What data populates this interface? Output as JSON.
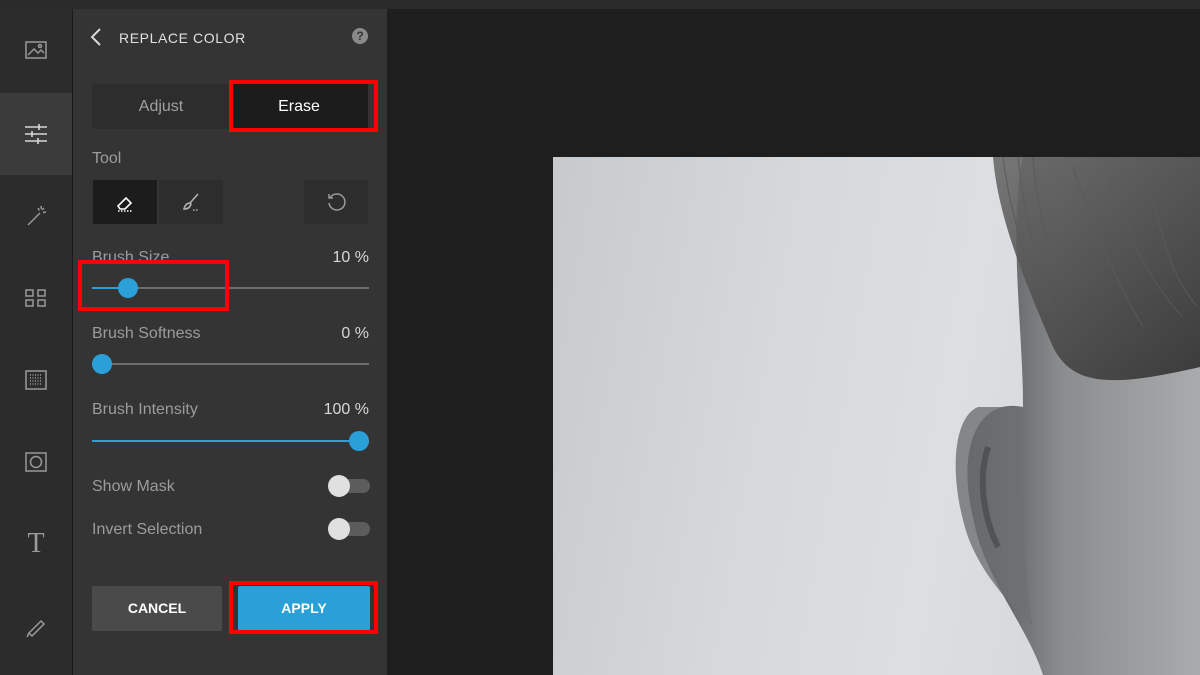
{
  "panel": {
    "title": "REPLACE COLOR",
    "help_symbol": "?",
    "tabs": [
      {
        "label": "Adjust",
        "selected": false
      },
      {
        "label": "Erase",
        "selected": true
      }
    ],
    "tool_label": "Tool",
    "tools": [
      "eraser-icon",
      "brush-icon",
      "reset-icon"
    ],
    "brush_size": {
      "label": "Brush Size",
      "value_text": "10 %",
      "value": 10
    },
    "brush_softness": {
      "label": "Brush Softness",
      "value_text": "0 %",
      "value": 0
    },
    "brush_intensity": {
      "label": "Brush Intensity",
      "value_text": "100 %",
      "value": 100
    },
    "show_mask": {
      "label": "Show Mask",
      "on": false
    },
    "invert_selection": {
      "label": "Invert Selection",
      "on": false
    },
    "cancel_label": "CANCEL",
    "apply_label": "APPLY"
  },
  "rail": {
    "icons": [
      "image-icon",
      "sliders-icon",
      "magic-wand-icon",
      "grid-icon",
      "texture-icon",
      "frame-icon",
      "text-icon",
      "draw-icon"
    ],
    "active": "sliders-icon",
    "text_glyph": "T"
  },
  "colors": {
    "accent": "#2a9fd8",
    "highlight": "#ff0000",
    "panel": "#343434",
    "rail": "#2c2c2c"
  }
}
